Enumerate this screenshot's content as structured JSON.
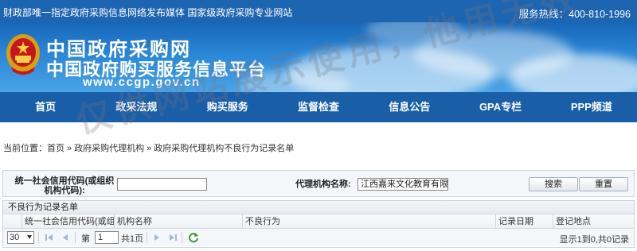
{
  "topbar": {
    "slogan": "财政部唯一指定政府采购信息网络发布媒体 国家级政府采购专业网站",
    "hotline_label": "服务热线：",
    "hotline_number": "400-810-1996"
  },
  "banner": {
    "title": "中国政府采购网",
    "subtitle": "中国政府购买服务信息平台",
    "url": "www.ccgp.gov.cn"
  },
  "nav": {
    "items": [
      "首页",
      "政采法规",
      "购买服务",
      "监督检查",
      "信息公告",
      "GPA专栏",
      "PPP频道"
    ]
  },
  "breadcrumb": {
    "label": "当前位置：",
    "items": [
      "首页",
      "政府采购代理机构",
      "政府采购代理机构不良行为记录名单"
    ],
    "separator": "»"
  },
  "search": {
    "credit_code_label": "统一社会信用代码(或组织机构代码):",
    "credit_code_value": "",
    "agency_name_label": "代理机构名称:",
    "agency_name_value": "江西嘉来文化教育有限公司",
    "search_button": "搜索",
    "reset_button": "重置"
  },
  "grid": {
    "title": "不良行为记录名单",
    "columns": [
      "统一社会信用代码(或组织机构代码)",
      "机构名称",
      "不良行为",
      "记录日期",
      "登记地点"
    ],
    "rows": []
  },
  "pager": {
    "page_size": "30",
    "page_prefix": "第",
    "current_page": "1",
    "page_suffix": "共1页",
    "status": "显示1到0,共0记录"
  },
  "watermark": "仅供网站展示使用，他用无效",
  "colors": {
    "topbar": "#1d64b1",
    "nav": "#1a5ea8",
    "banner_sky": "#2a86d6"
  }
}
